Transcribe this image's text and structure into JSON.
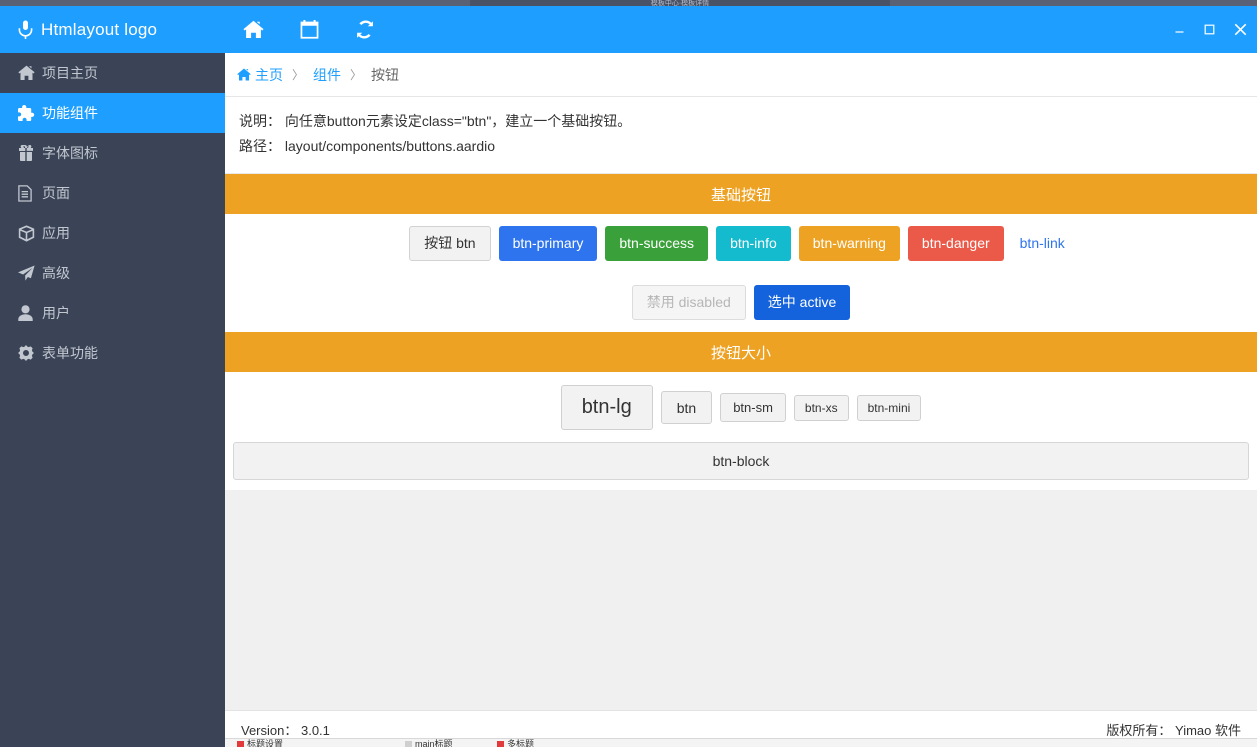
{
  "background_window": {
    "top_title": "模板中心·模板详情",
    "bottom_items": [
      {
        "label": "标题设置",
        "marker_color": "#e23a3a"
      },
      {
        "label": "main标题",
        "marker_color": "#cfcfcf"
      },
      {
        "label": "多标题",
        "marker_color": "#e23a3a"
      }
    ]
  },
  "sidebar": {
    "brand": {
      "label": "Htmlayout logo",
      "icon": "microphone-icon"
    },
    "items": [
      {
        "label": "项目主页",
        "icon": "home-icon",
        "active": false
      },
      {
        "label": "功能组件",
        "icon": "puzzle-icon",
        "active": true
      },
      {
        "label": "字体图标",
        "icon": "gift-icon",
        "active": false
      },
      {
        "label": "页面",
        "icon": "file-icon",
        "active": false
      },
      {
        "label": "应用",
        "icon": "cube-icon",
        "active": false
      },
      {
        "label": "高级",
        "icon": "paper-plane-icon",
        "active": false
      },
      {
        "label": "用户",
        "icon": "user-icon",
        "active": false
      },
      {
        "label": "表单功能",
        "icon": "gear-icon",
        "active": false
      }
    ]
  },
  "toolbar": {
    "buttons": [
      {
        "name": "home-icon",
        "title": "主页"
      },
      {
        "name": "calendar-icon",
        "title": "日历"
      },
      {
        "name": "refresh-icon",
        "title": "刷新"
      }
    ],
    "window_controls": [
      {
        "name": "minimize-button",
        "glyph": "—"
      },
      {
        "name": "maximize-button",
        "glyph": "▢"
      },
      {
        "name": "close-button",
        "glyph": "✕"
      }
    ]
  },
  "breadcrumb": {
    "home": "主页",
    "sep": "〉",
    "level2": "组件",
    "current": "按钮"
  },
  "description": {
    "line1": "说明： 向任意button元素设定class=\"btn\"，建立一个基础按钮。",
    "line2": "路径： layout/components/buttons.aardio"
  },
  "sections": [
    {
      "title": "基础按钮",
      "rows": [
        [
          {
            "label": "按钮 btn",
            "style": "default"
          },
          {
            "label": "btn-primary",
            "style": "primary"
          },
          {
            "label": "btn-success",
            "style": "success"
          },
          {
            "label": "btn-info",
            "style": "info"
          },
          {
            "label": "btn-warning",
            "style": "warning"
          },
          {
            "label": "btn-danger",
            "style": "danger"
          },
          {
            "label": "btn-link",
            "style": "link"
          }
        ],
        [
          {
            "label": "禁用 disabled",
            "style": "disabled"
          },
          {
            "label": "选中 active",
            "style": "active"
          }
        ]
      ]
    },
    {
      "title": "按钮大小",
      "sizes": [
        {
          "label": "btn-lg",
          "size": "lg"
        },
        {
          "label": "btn",
          "size": "md"
        },
        {
          "label": "btn-sm",
          "size": "sm"
        },
        {
          "label": "btn-xs",
          "size": "xs"
        },
        {
          "label": "btn-mini",
          "size": "mini"
        }
      ],
      "block": {
        "label": "btn-block"
      }
    }
  ],
  "footer": {
    "version": "Version： 3.0.1",
    "copyright": "版权所有： Yimao 软件"
  },
  "colors": {
    "brand_blue": "#1e9fff",
    "sidebar_bg": "#3a4456",
    "section_orange": "#eda223",
    "primary": "#2f74ef",
    "success": "#3aa13a",
    "info": "#14bacd",
    "warning": "#eda223",
    "danger": "#eb5a48",
    "active": "#1463dd"
  }
}
